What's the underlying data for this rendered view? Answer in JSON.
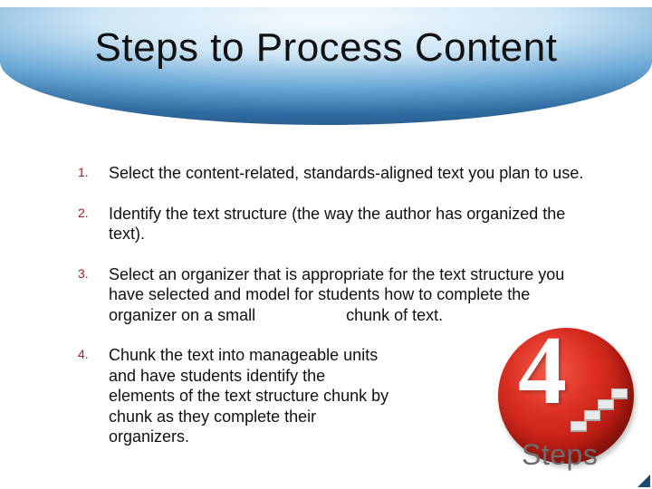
{
  "title": "Steps to Process Content",
  "items": [
    {
      "n": "1.",
      "text": "Select the content-related, standards-aligned text you plan to use."
    },
    {
      "n": "2.",
      "text": "Identify the text structure (the way the author has organized the text)."
    },
    {
      "n": "3.",
      "text": "Select an organizer that is appropriate for the text structure you have selected and model for students how to complete the organizer on a small                    chunk of text."
    },
    {
      "n": "4.",
      "text": "Chunk the text into manageable units and have students identify the elements of the text structure chunk by chunk as they complete their organizers."
    }
  ],
  "badge": {
    "number": "4",
    "label": "Steps"
  }
}
